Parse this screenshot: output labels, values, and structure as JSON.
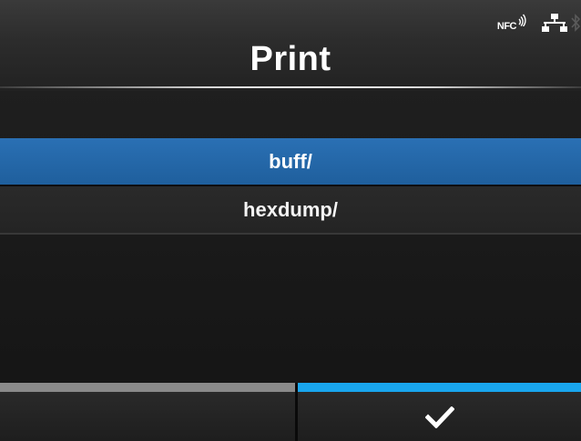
{
  "header": {
    "title": "Print",
    "status_icons": {
      "nfc_label": "NFC",
      "nfc_icon": "nfc-waves-icon",
      "network_icon": "network-icon",
      "bluetooth_icon": "bluetooth-icon"
    }
  },
  "list": {
    "items": [
      {
        "label": "buff/",
        "selected": true
      },
      {
        "label": "hexdump/",
        "selected": false
      }
    ]
  },
  "softkeys": {
    "left": {
      "label": "",
      "bar_color": "#8a8a8a"
    },
    "right": {
      "icon": "checkmark-icon",
      "bar_color": "#19a6ee"
    }
  },
  "colors": {
    "selection": "#2a70b4",
    "accent": "#19a6ee",
    "background": "#1c1c1c"
  }
}
